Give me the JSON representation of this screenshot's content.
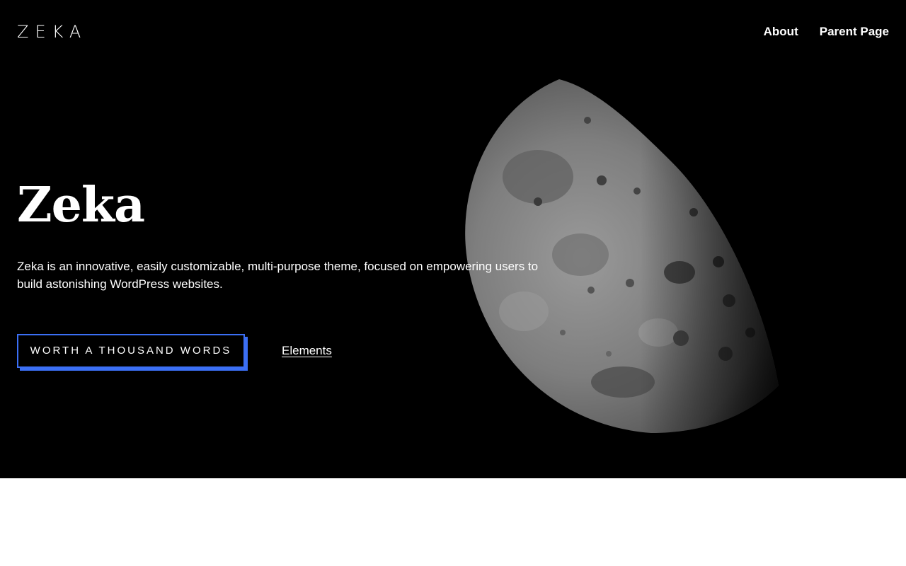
{
  "header": {
    "logo": "ZEKA",
    "nav": [
      {
        "label": "About"
      },
      {
        "label": "Parent Page"
      }
    ]
  },
  "hero": {
    "title": "Zeka",
    "description": "Zeka is an innovative, easily customizable, multi-purpose theme, focused on empowering users to build astonishing WordPress websites.",
    "primary_button": "WORTH A THOUSAND WORDS",
    "secondary_link": "Elements",
    "image_icon": "moon-image"
  },
  "colors": {
    "background": "#000000",
    "text": "#ffffff",
    "accent": "#3b6ff5",
    "below_fold": "#ffffff"
  }
}
